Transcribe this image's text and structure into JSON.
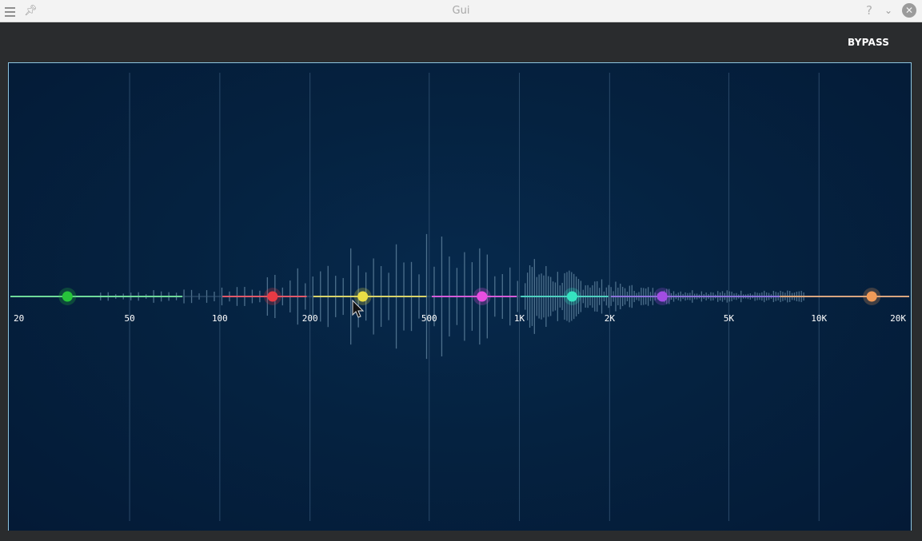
{
  "window": {
    "title": "Gui"
  },
  "toolbar": {
    "bypass_label": "BYPASS"
  },
  "chart_data": {
    "type": "scatter",
    "x_scale": "log",
    "x_range": [
      20,
      20000
    ],
    "x_ticks": [
      20,
      50,
      100,
      200,
      500,
      1000,
      2000,
      5000,
      10000,
      20000
    ],
    "x_tick_labels": [
      "20",
      "50",
      "100",
      "200",
      "500",
      "1K",
      "2K",
      "5K",
      "10K",
      "20K"
    ],
    "grid": true,
    "bands": [
      {
        "color": "#27c43a",
        "line_color": "#6ed99a",
        "node_hz": 31,
        "range_hz": [
          20,
          75
        ]
      },
      {
        "color": "#e83a44",
        "line_color": "#e0596a",
        "node_hz": 150,
        "range_hz": [
          102,
          195
        ]
      },
      {
        "color": "#e9dd45",
        "line_color": "#d9d36a",
        "node_hz": 300,
        "range_hz": [
          205,
          490
        ]
      },
      {
        "color": "#e84ee0",
        "line_color": "#d55cd8",
        "node_hz": 750,
        "range_hz": [
          510,
          980
        ]
      },
      {
        "color": "#35e3c0",
        "line_color": "#4fd0c0",
        "node_hz": 1500,
        "range_hz": [
          1010,
          1980
        ]
      },
      {
        "color": "#a24de3",
        "line_color": "#8a73d8",
        "node_hz": 3000,
        "range_hz": [
          2020,
          7400
        ]
      },
      {
        "color": "#ef9a58",
        "line_color": "#d9a57f",
        "node_hz": 15000,
        "range_hz": [
          7400,
          20000
        ]
      }
    ]
  }
}
